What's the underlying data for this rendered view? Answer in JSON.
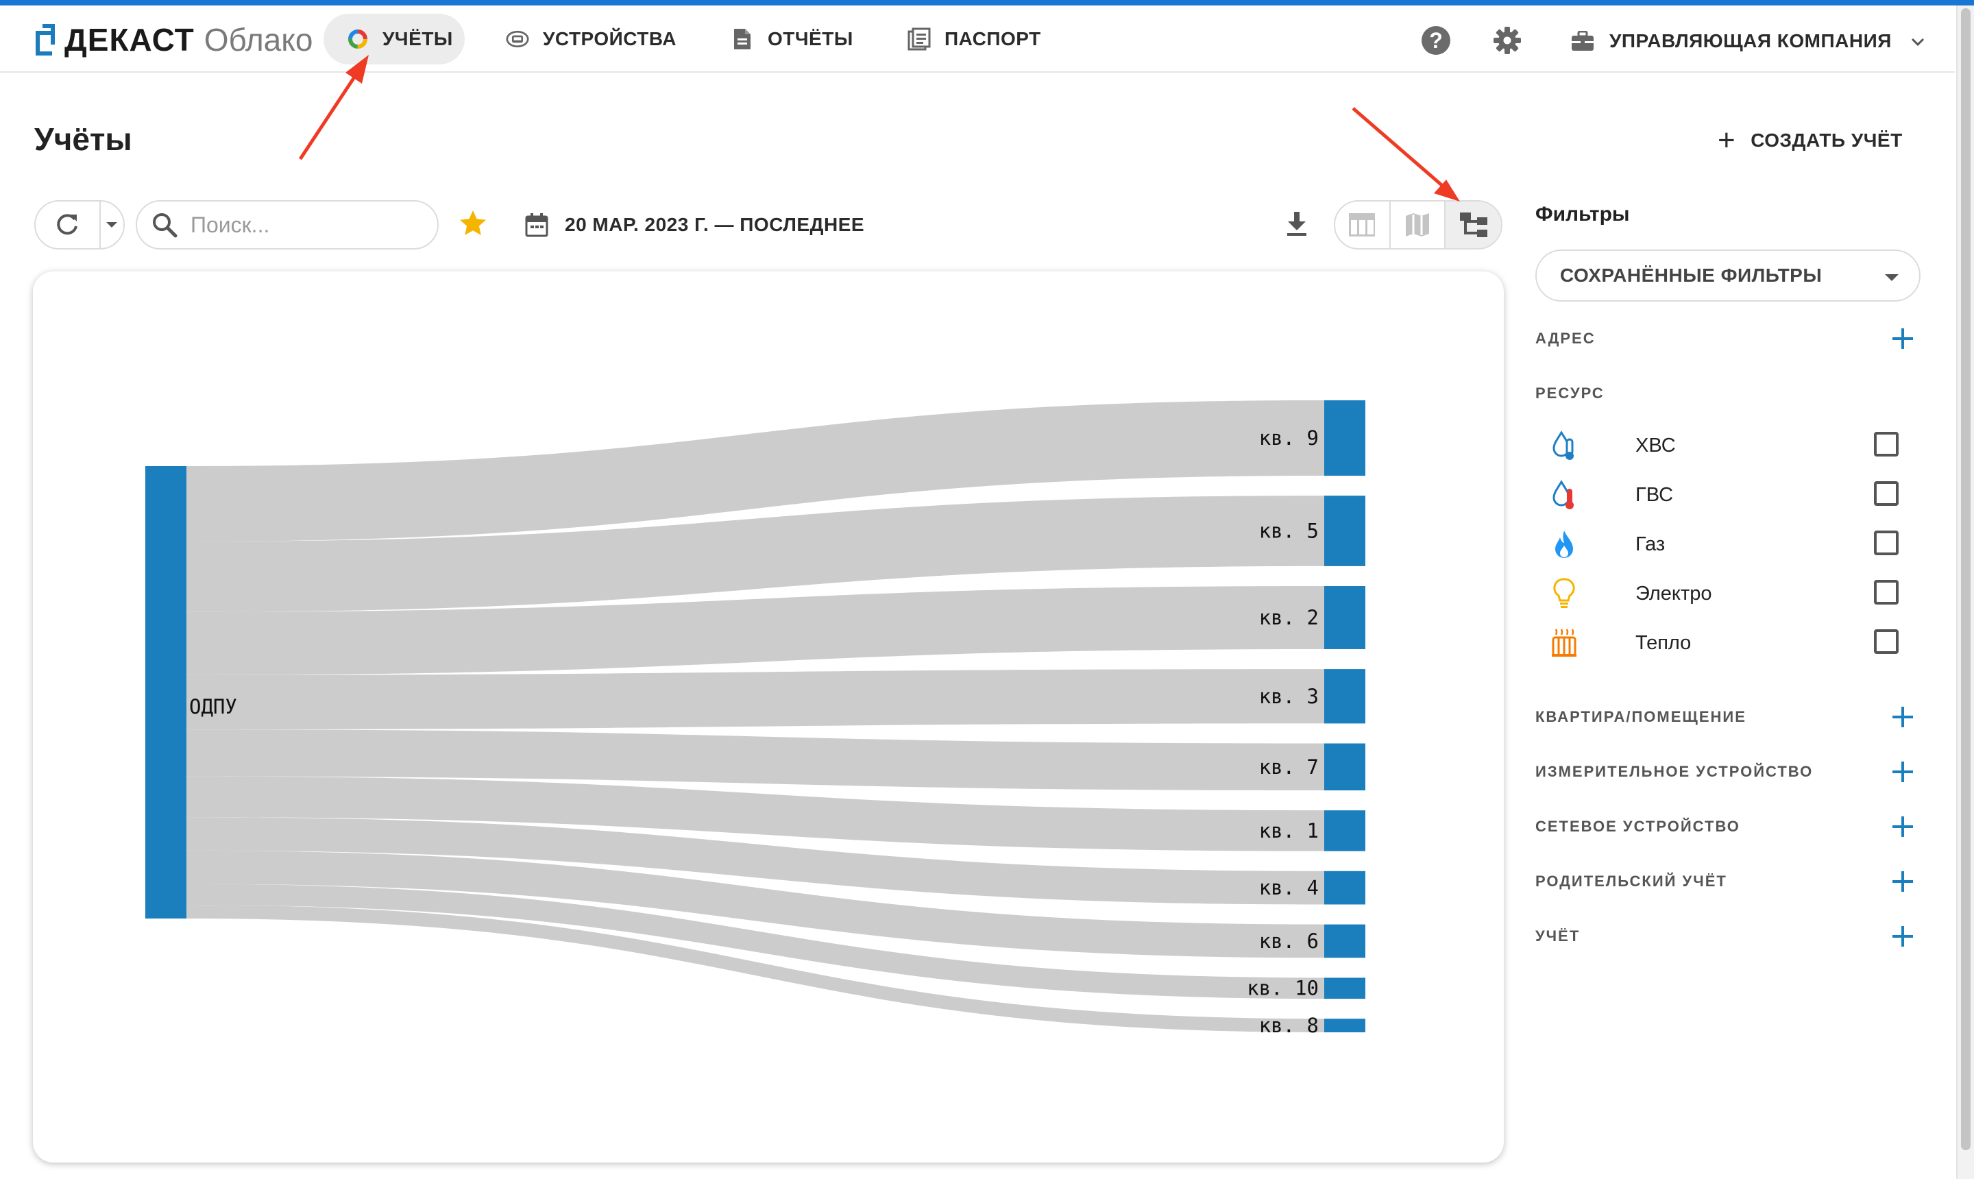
{
  "header": {
    "brand": "ДЕКАСТ",
    "brand_sub": "Облако",
    "nav": [
      {
        "label": "УЧЁТЫ",
        "icon": "multicolor-ring-icon",
        "active": true
      },
      {
        "label": "УСТРОЙСТВА",
        "icon": "device-icon",
        "active": false
      },
      {
        "label": "ОТЧЁТЫ",
        "icon": "document-icon",
        "active": false
      },
      {
        "label": "ПАСПОРТ",
        "icon": "passport-icon",
        "active": false
      }
    ],
    "help_glyph": "?",
    "company": "УПРАВЛЯЮЩАЯ КОМПАНИЯ"
  },
  "page": {
    "title": "Учёты",
    "create_button": "СОЗДАТЬ УЧЁТ",
    "create_glyph": "+"
  },
  "toolbar": {
    "search_placeholder": "Поиск...",
    "date_range": "20 МАР. 2023 Г. — ПОСЛЕДНЕЕ",
    "views": [
      "table-view-icon",
      "map-view-icon",
      "tree-view-icon"
    ],
    "active_view": "tree-view-icon"
  },
  "filters": {
    "title": "Фильтры",
    "saved_filters": "СОХРАНЁННЫЕ ФИЛЬТРЫ",
    "address": "АДРЕС",
    "resource": "РЕСУРС",
    "resources": [
      {
        "label": "ХВС",
        "icon": "cold-water-icon",
        "color": "#1f7fc4",
        "checked": false
      },
      {
        "label": "ГВС",
        "icon": "hot-water-icon",
        "color": "#e53935",
        "checked": false
      },
      {
        "label": "Газ",
        "icon": "gas-flame-icon",
        "color": "#2196f3",
        "checked": false
      },
      {
        "label": "Электро",
        "icon": "lightbulb-icon",
        "color": "#f4b400",
        "checked": false
      },
      {
        "label": "Тепло",
        "icon": "radiator-icon",
        "color": "#f57c00",
        "checked": false
      }
    ],
    "sections": [
      "КВАРТИРА/ПОМЕЩЕНИЕ",
      "ИЗМЕРИТЕЛЬНОЕ УСТРОЙСТВО",
      "СЕТЕВОЕ УСТРОЙСТВО",
      "РОДИТЕЛЬСКИЙ УЧЁТ",
      "УЧЁТ"
    ]
  },
  "colors": {
    "accent": "#1976d2",
    "node": "#1b7fbd",
    "link": "#cccccc",
    "annotation_arrow": "#ef3b24"
  },
  "chart_data": {
    "type": "sankey",
    "source": "ОДПУ",
    "targets": [
      {
        "name": "кв. 9",
        "value": 61
      },
      {
        "name": "кв. 5",
        "value": 57
      },
      {
        "name": "кв. 2",
        "value": 51
      },
      {
        "name": "кв. 3",
        "value": 44
      },
      {
        "name": "кв. 7",
        "value": 38
      },
      {
        "name": "кв. 1",
        "value": 33
      },
      {
        "name": "кв. 4",
        "value": 27
      },
      {
        "name": "кв. 6",
        "value": 27
      },
      {
        "name": "кв. 10",
        "value": 17
      },
      {
        "name": "кв. 8",
        "value": 11
      }
    ]
  }
}
